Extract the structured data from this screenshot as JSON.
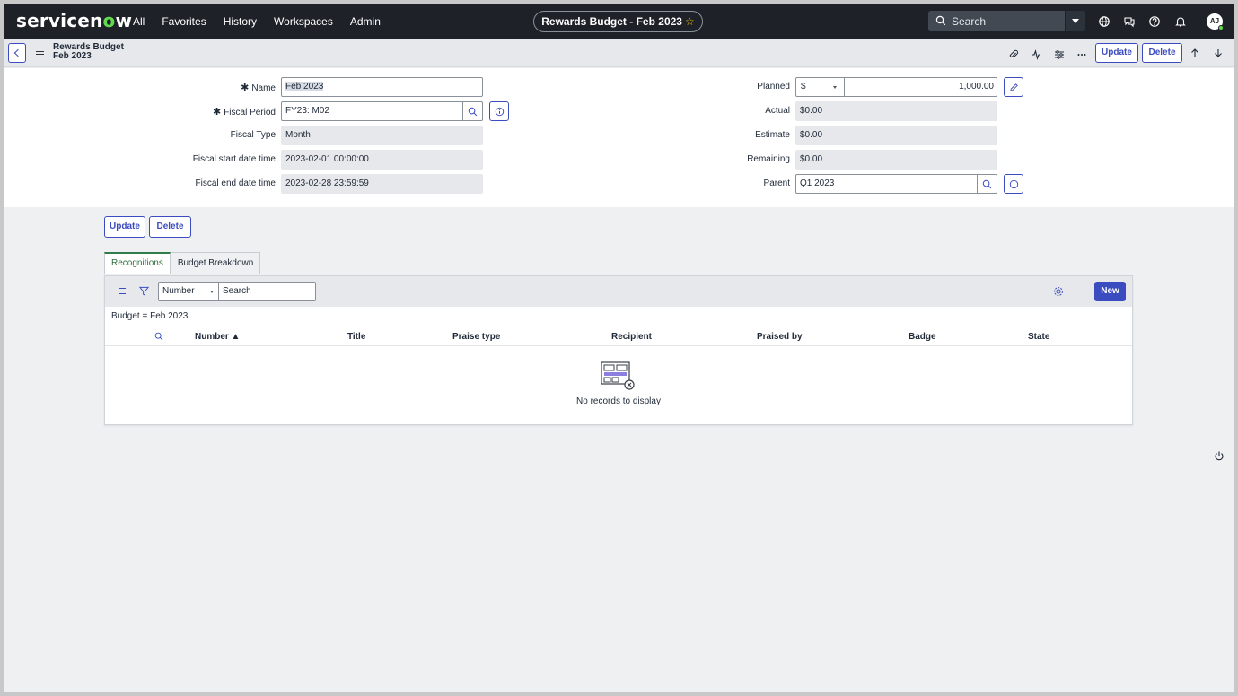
{
  "topnav": {
    "logo_text_a": "servicen",
    "logo_text_o": "o",
    "logo_text_b": "w",
    "links": [
      "All",
      "Favorites",
      "History",
      "Workspaces",
      "Admin"
    ],
    "record_title": "Rewards Budget - Feb 2023",
    "search_placeholder": "Search",
    "avatar_initials": "AJ"
  },
  "record_header": {
    "title_line1": "Rewards Budget",
    "title_line2": "Feb 2023",
    "update_label": "Update",
    "delete_label": "Delete"
  },
  "form": {
    "name_label": "Name",
    "name_value": "Feb 2023",
    "fiscal_period_label": "Fiscal Period",
    "fiscal_period_value": "FY23: M02",
    "fiscal_type_label": "Fiscal Type",
    "fiscal_type_value": "Month",
    "fiscal_start_label": "Fiscal start date time",
    "fiscal_start_value": "2023-02-01 00:00:00",
    "fiscal_end_label": "Fiscal end date time",
    "fiscal_end_value": "2023-02-28 23:59:59",
    "planned_label": "Planned",
    "planned_currency": "$",
    "planned_value": "1,000.00",
    "actual_label": "Actual",
    "actual_value": "$0.00",
    "estimate_label": "Estimate",
    "estimate_value": "$0.00",
    "remaining_label": "Remaining",
    "remaining_value": "$0.00",
    "parent_label": "Parent",
    "parent_value": "Q1 2023",
    "required_marker": "✱"
  },
  "actions": {
    "update_label": "Update",
    "delete_label": "Delete"
  },
  "tabs": [
    "Recognitions",
    "Budget Breakdown"
  ],
  "related_list": {
    "field_select": "Number",
    "search_placeholder": "Search",
    "new_label": "New",
    "breadcrumb": "Budget = Feb 2023",
    "columns": [
      "Number ▲",
      "Title",
      "Praise type",
      "Recipient",
      "Praised by",
      "Badge",
      "State"
    ],
    "empty_message": "No records to display"
  },
  "colors": {
    "nav_bg": "#1e2228",
    "accent": "#3b4cc0",
    "brand_green": "#62d84e",
    "tab_active": "#2f7d4a"
  }
}
